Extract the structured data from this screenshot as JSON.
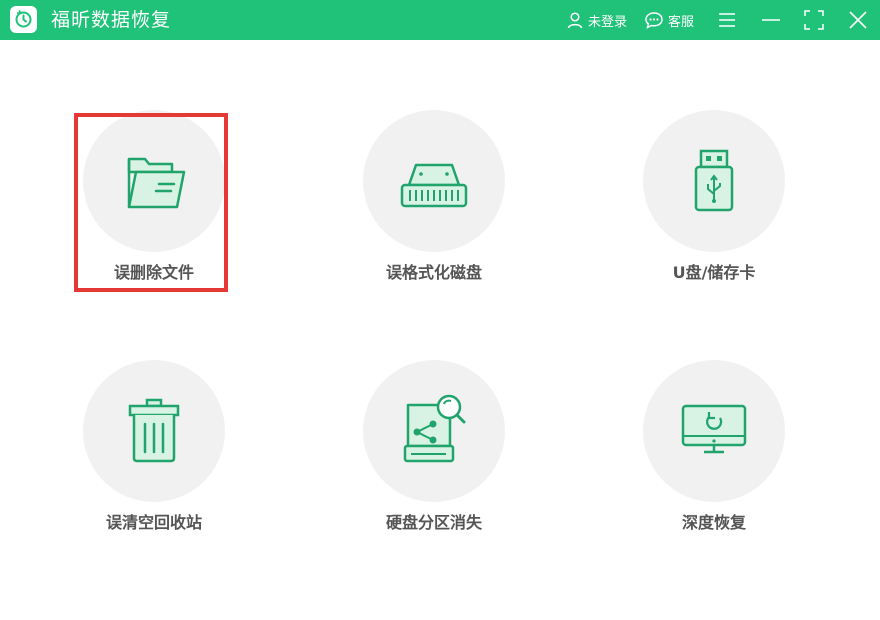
{
  "app": {
    "title": "福昕数据恢复"
  },
  "header": {
    "login_label": "未登录",
    "service_label": "客服"
  },
  "colors": {
    "brand": "#20c27a",
    "highlight": "#e53935",
    "icon_stroke": "#20a46c",
    "icon_fill": "#d8f3e3"
  },
  "recovery_modes": [
    {
      "label": "误删除文件",
      "icon": "folder-icon",
      "selected": true
    },
    {
      "label": "误格式化磁盘",
      "icon": "hard-drive-icon",
      "selected": false
    },
    {
      "label": "U盘/储存卡",
      "icon": "usb-drive-icon",
      "selected": false
    },
    {
      "label": "误清空回收站",
      "icon": "recycle-bin-icon",
      "selected": false
    },
    {
      "label": "硬盘分区消失",
      "icon": "partition-search-icon",
      "selected": false
    },
    {
      "label": "深度恢复",
      "icon": "monitor-restore-icon",
      "selected": false
    }
  ]
}
